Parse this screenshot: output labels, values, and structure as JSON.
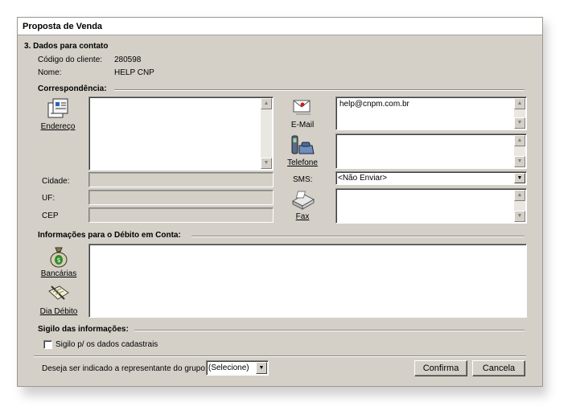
{
  "window": {
    "title": "Proposta de Venda"
  },
  "section_contato": {
    "heading": "3. Dados para contato",
    "codigo_label": "Código do cliente:",
    "codigo_value": "280598",
    "nome_label": "Nome:",
    "nome_value": "HELP CNP"
  },
  "correspondencia": {
    "heading": "Correspondência:",
    "endereco_label": "Endereço",
    "endereco_value": "",
    "cidade_label": "Cidade:",
    "uf_label": "UF:",
    "cep_label": "CEP",
    "email_label": "E-Mail",
    "email_value": "help@cnpm.com.br",
    "telefone_label": "Telefone",
    "telefone_value": "",
    "sms_label": "SMS:",
    "sms_value": "<Não Enviar>",
    "fax_label": "Fax",
    "fax_value": ""
  },
  "debito": {
    "heading": "Informações para o Débito em Conta:",
    "bancarias_label": "Bancárias",
    "dia_label": "Dia Débito"
  },
  "sigilo": {
    "heading": "Sigilo das informações:",
    "checkbox_label": "Sigilo p/ os dados cadastrais",
    "checked": false
  },
  "footer": {
    "question": "Deseja ser indicado a representante do grupo:",
    "select_value": "(Selecione)",
    "confirma": "Confirma",
    "cancela": "Cancela"
  },
  "icons": {
    "scroll_up": "▲",
    "scroll_down": "▼",
    "dropdown": "▼"
  }
}
